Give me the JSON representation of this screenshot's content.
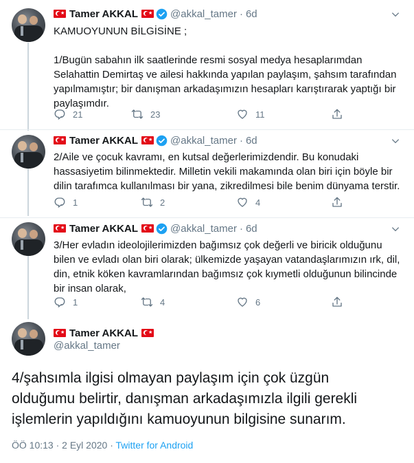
{
  "colors": {
    "accent": "#1da1f2",
    "text": "#14171a",
    "muted": "#657786",
    "like": "#657786",
    "flag": "#e30a17"
  },
  "author": {
    "name": "Tamer AKKAL",
    "handle": "@akkal_tamer"
  },
  "tweets": [
    {
      "time": "6d",
      "lines": [
        "KAMUOYUNUN BİLGİSİNE ;",
        "",
        "1/Bugün sabahın ilk saatlerinde resmi sosyal medya hesaplarımdan",
        "Selahattin Demirtaş ve ailesi hakkında yapılan paylaşım, şahsım tarafından",
        "yapılmamıştır; bir danışman arkadaşımızın hesapları karıştırarak yaptığı bir",
        "paylaşımdır."
      ],
      "replies": "21",
      "retweets": "23",
      "likes": "11"
    },
    {
      "time": "6d",
      "lines": [
        "2/Aile ve çocuk kavramı, en kutsal değerlerimizdendir. Bu konudaki",
        "hassasiyetim bilinmektedir. Milletin vekili makamında olan biri için böyle bir",
        "dilin tarafımca kullanılması bir yana, zikredilmesi bile benim dünyama terstir."
      ],
      "replies": "1",
      "retweets": "2",
      "likes": "4"
    },
    {
      "time": "6d",
      "lines": [
        "3/Her evladın ideolojilerimizden bağımsız çok değerli ve biricik olduğunu",
        "bilen ve evladı olan biri olarak; ülkemizde yaşayan vatandaşlarımızın ırk, dil,",
        "din, etnik köken kavramlarından bağımsız çok kıymetli olduğunun bilincinde",
        "bir insan olarak,"
      ],
      "replies": "1",
      "retweets": "4",
      "likes": "6"
    }
  ],
  "main": {
    "lines": [
      "4/şahsımla ilgisi olmayan paylaşım için çok üzgün",
      "olduğumu belirtir, danışman arkadaşımızla ilgili gerekli",
      "işlemlerin yapıldığını kamuoyunun bilgisine sunarım."
    ],
    "timestamp": "ÖÖ 10:13 · 2 Eyl 2020 · ",
    "source": "Twitter for Android"
  },
  "icons": {
    "reply": "reply-icon",
    "retweet": "retweet-icon",
    "like": "heart-icon",
    "share": "share-icon",
    "more": "chevron-down-icon",
    "verified": "verified-badge-icon",
    "flag": "turkish-flag-icon"
  }
}
